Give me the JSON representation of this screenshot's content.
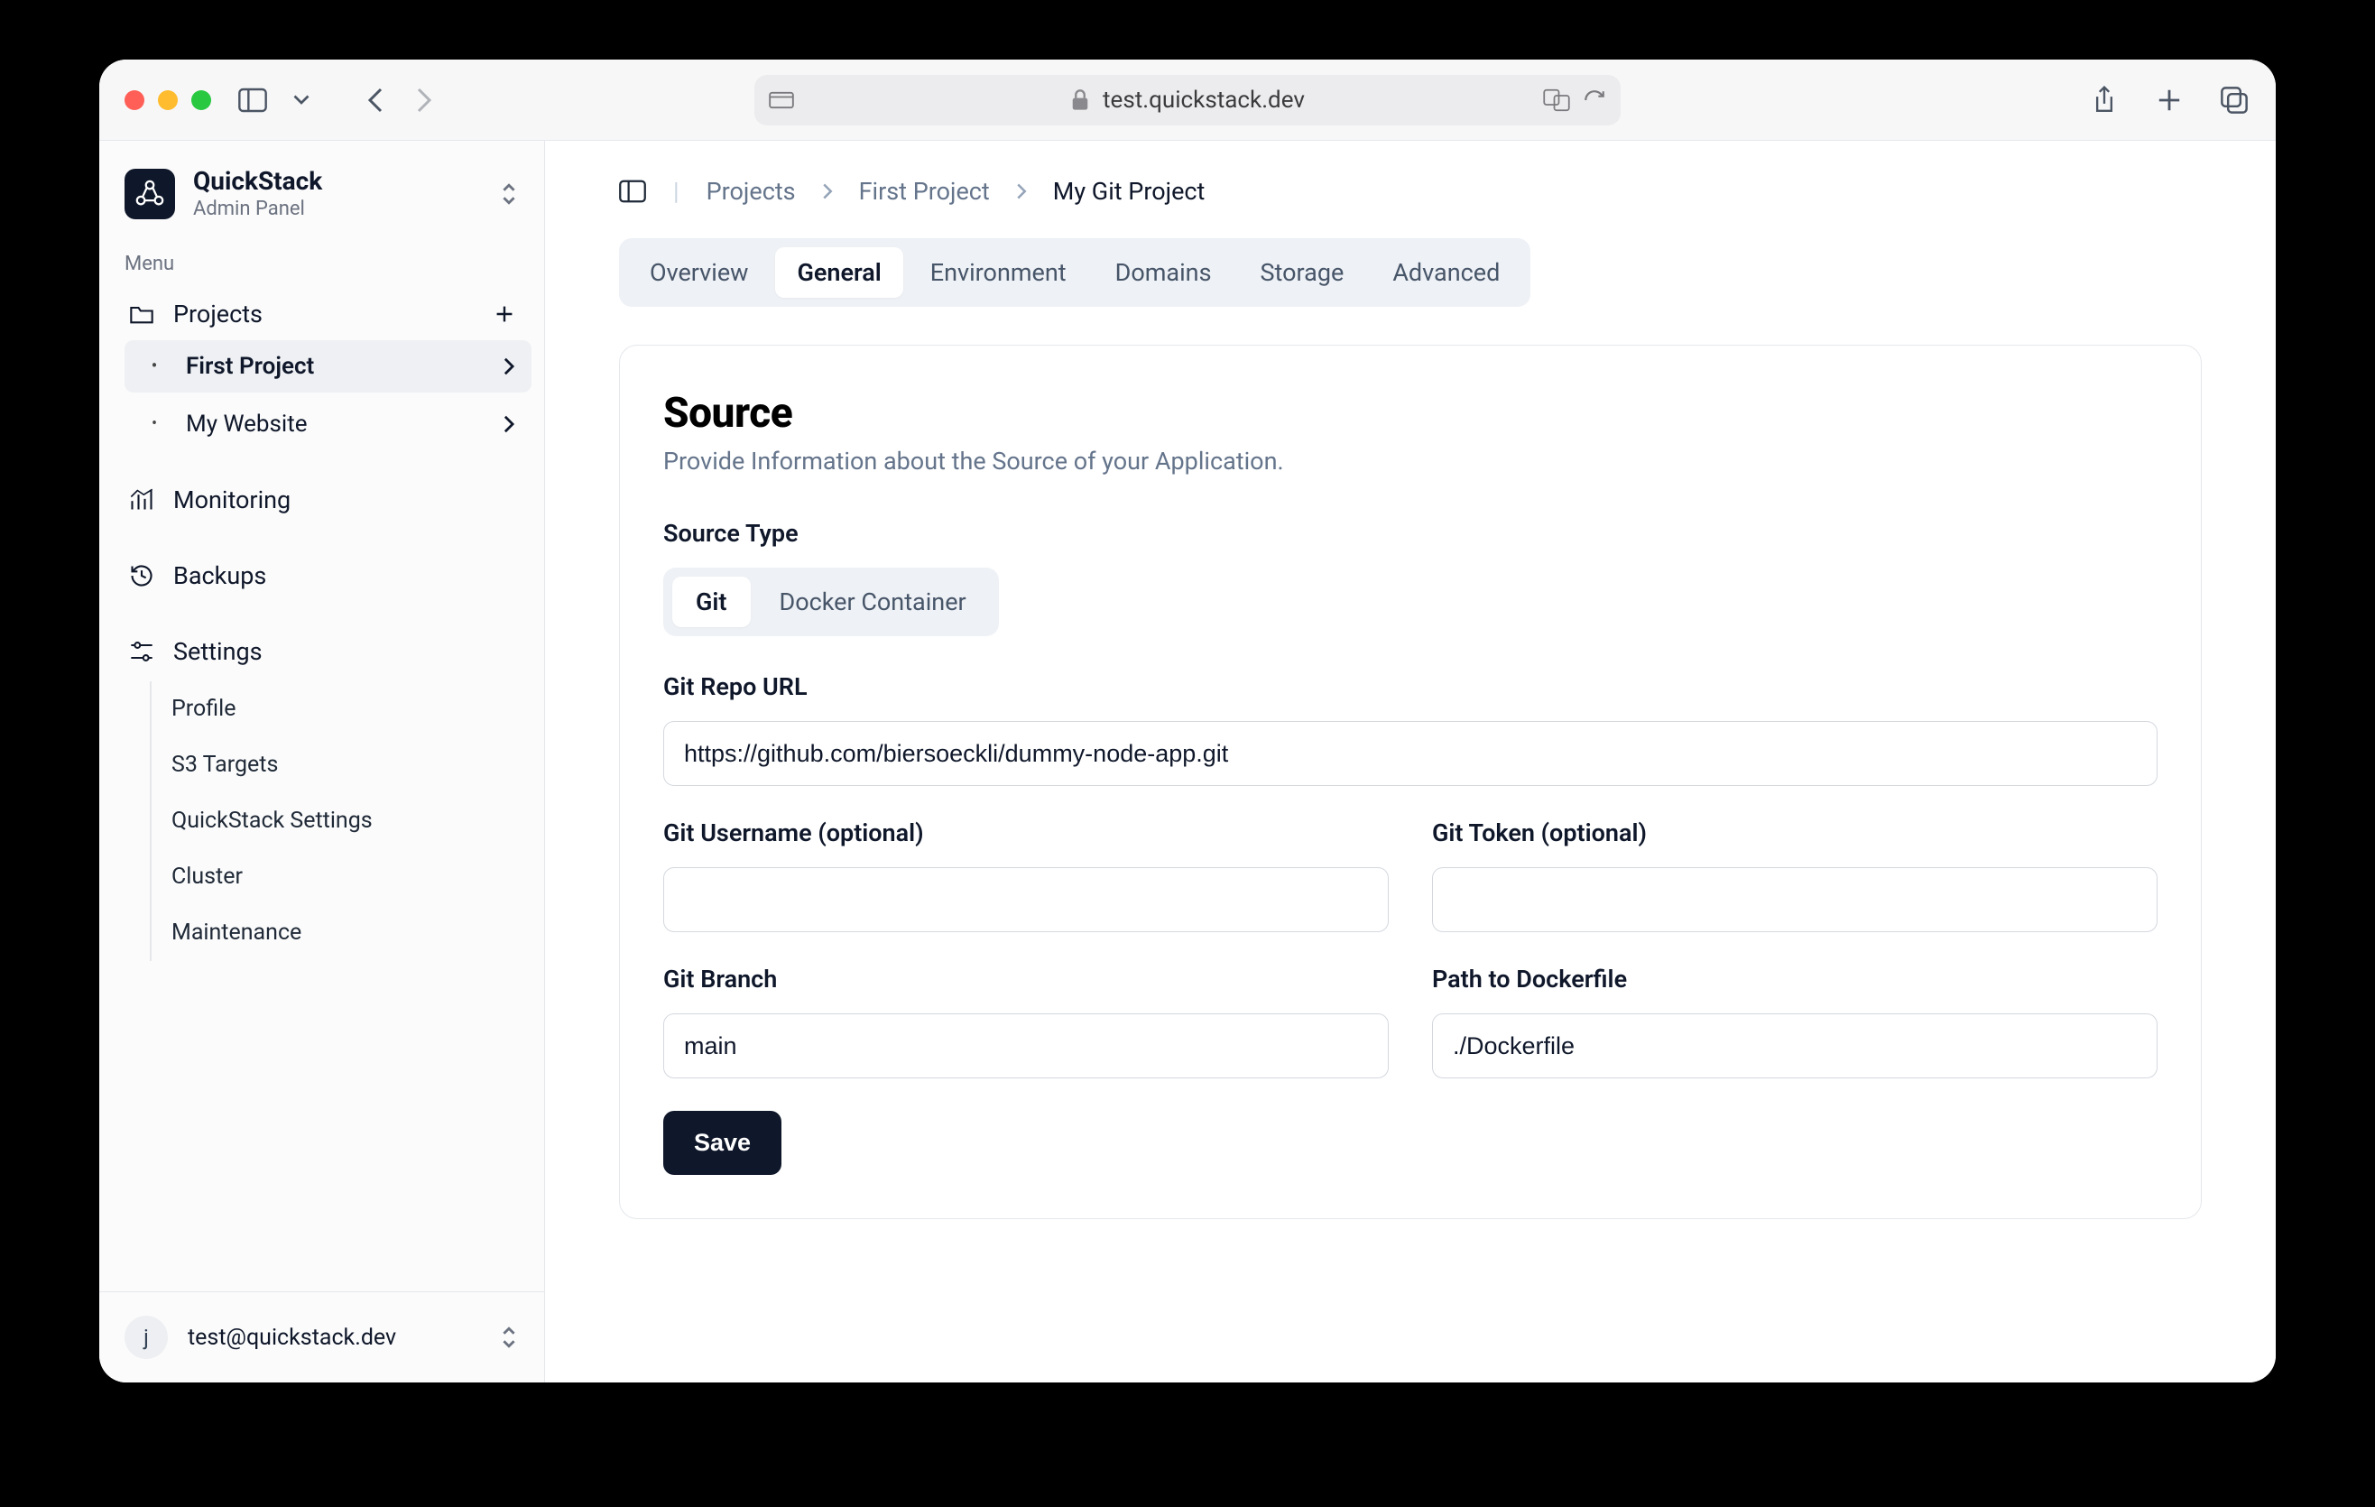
{
  "browser": {
    "url_display": "test.quickstack.dev"
  },
  "sidebar": {
    "brand_title": "QuickStack",
    "brand_subtitle": "Admin Panel",
    "menu_label": "Menu",
    "items": {
      "projects_label": "Projects",
      "project_children": [
        {
          "label": "First Project",
          "active": true
        },
        {
          "label": "My Website",
          "active": false
        }
      ],
      "monitoring_label": "Monitoring",
      "backups_label": "Backups",
      "settings_label": "Settings",
      "settings_children": [
        "Profile",
        "S3 Targets",
        "QuickStack Settings",
        "Cluster",
        "Maintenance"
      ]
    },
    "footer_email": "test@quickstack.dev",
    "footer_initial": "j"
  },
  "breadcrumbs": [
    "Projects",
    "First Project",
    "My Git Project"
  ],
  "tabs": [
    "Overview",
    "General",
    "Environment",
    "Domains",
    "Storage",
    "Advanced"
  ],
  "active_tab": "General",
  "card": {
    "title": "Source",
    "desc": "Provide Information about the Source of your Application.",
    "source_type_label": "Source Type",
    "source_type_options": [
      "Git",
      "Docker Container"
    ],
    "source_type_active": "Git",
    "git_url_label": "Git Repo URL",
    "git_url_value": "https://github.com/biersoeckli/dummy-node-app.git",
    "git_user_label": "Git Username (optional)",
    "git_user_value": "",
    "git_token_label": "Git Token (optional)",
    "git_token_value": "",
    "git_branch_label": "Git Branch",
    "git_branch_value": "main",
    "dockerfile_label": "Path to Dockerfile",
    "dockerfile_value": "./Dockerfile",
    "save_label": "Save"
  }
}
